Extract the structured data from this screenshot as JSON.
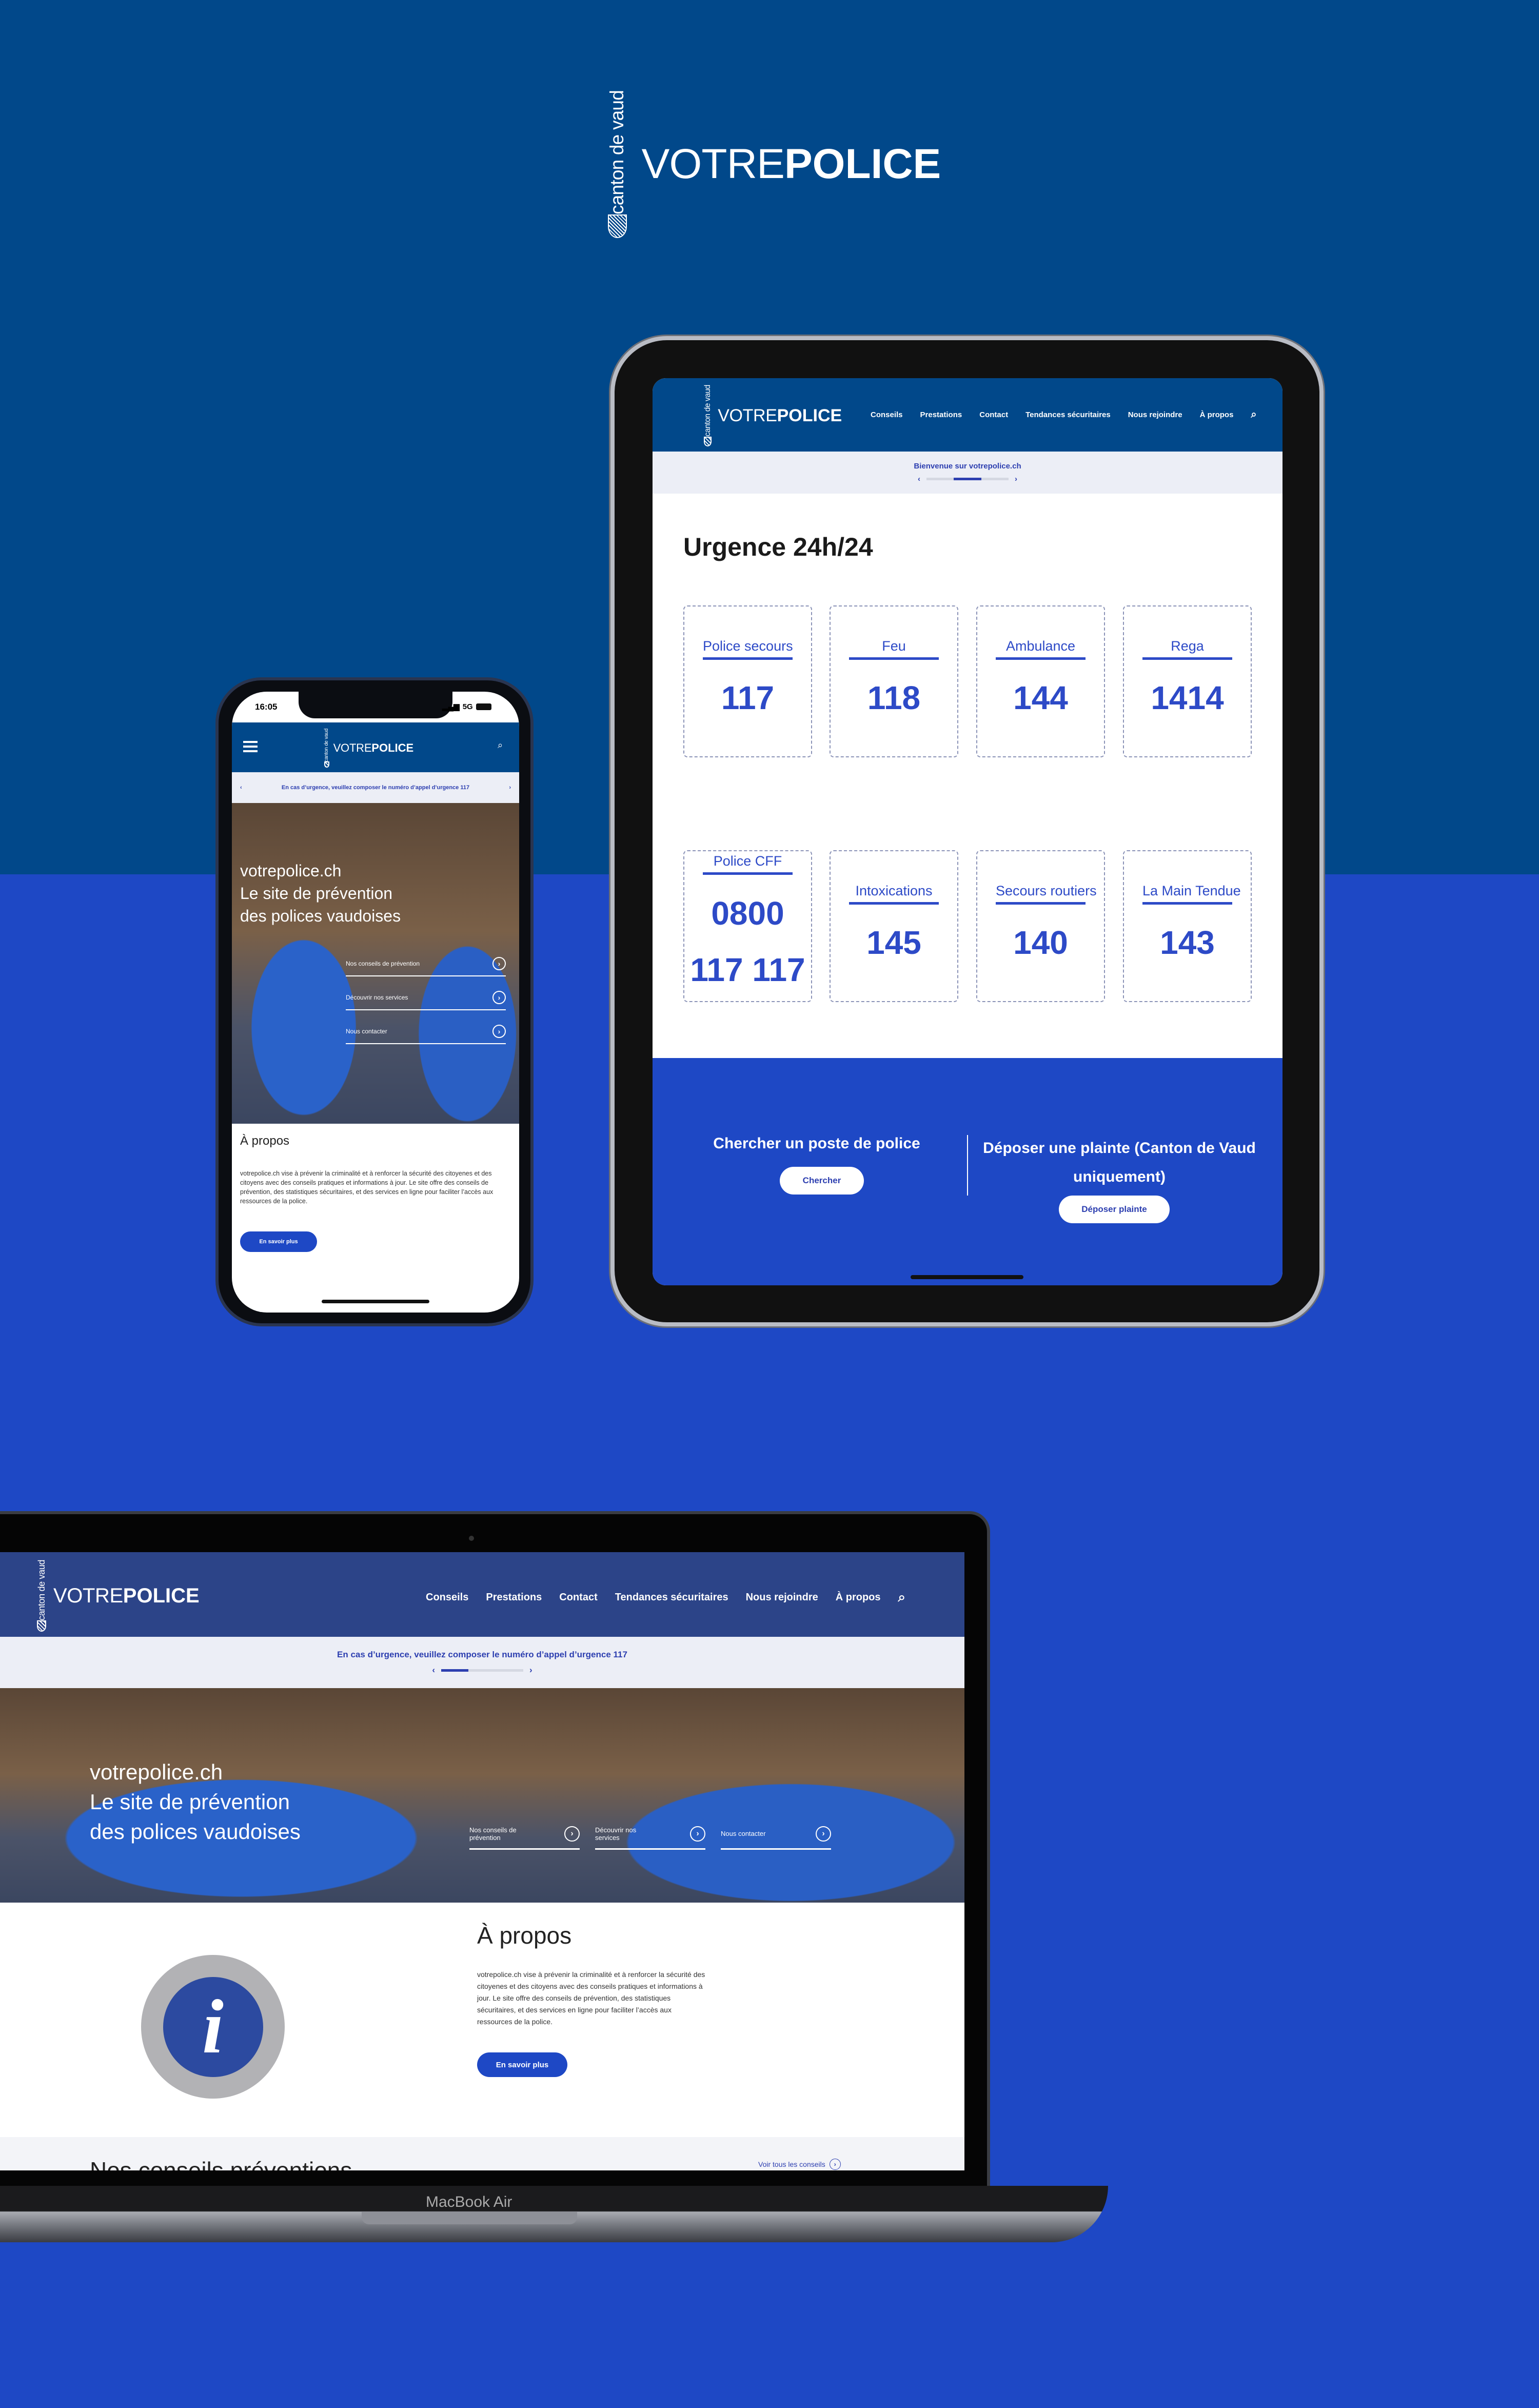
{
  "brand": {
    "seal_text": "canton de vaud",
    "name_light": "VOTRE",
    "name_bold": "POLICE"
  },
  "colors": {
    "dark_blue": "#01488a",
    "accent_blue": "#1e48c5",
    "laptop_header": "#2c4488",
    "banner_bg": "#eceef6"
  },
  "nav": {
    "items": [
      "Conseils",
      "Prestations",
      "Contact",
      "Tendances sécuritaires",
      "Nous rejoindre",
      "À propos"
    ],
    "search_icon": "search-icon"
  },
  "tablet": {
    "banner_text": "Bienvenue sur votrepolice.ch",
    "carousel_progress": 0.5,
    "title": "Urgence 24h/24",
    "cards": [
      {
        "label": "Police secours",
        "number": "117"
      },
      {
        "label": "Feu",
        "number": "118"
      },
      {
        "label": "Ambulance",
        "number": "144"
      },
      {
        "label": "Rega",
        "number": "1414"
      },
      {
        "label": "Police CFF",
        "number": "0800 117 117"
      },
      {
        "label": "Intoxications",
        "number": "145"
      },
      {
        "label": "Secours routiers",
        "number": "140"
      },
      {
        "label": "La Main Tendue",
        "number": "143"
      }
    ],
    "find_title": "Chercher un poste de police",
    "find_button": "Chercher",
    "complaint_title": "Déposer une plainte (Canton de Vaud uniquement)",
    "complaint_button": "Déposer plainte"
  },
  "phone": {
    "time": "16:05",
    "network": "5G",
    "banner_text": "En cas d’urgence, veuillez composer le numéro d’appel d’urgence 117",
    "hero_line1": "votrepolice.ch",
    "hero_line2": "Le site de prévention",
    "hero_line3": "des polices vaudoises",
    "links": [
      "Nos conseils de prévention",
      "Découvrir nos services",
      "Nous contacter"
    ],
    "about_title": "À propos",
    "about_text": "votrepolice.ch vise à prévenir la criminalité et à renforcer la sécurité des citoyenes et des citoyens avec des conseils pratiques et informations à jour. Le site offre des conseils de prévention, des statistiques sécuritaires, et des services en ligne pour faciliter l’accès aux ressources de la police.",
    "about_button": "En savoir plus"
  },
  "laptop": {
    "banner_text": "En cas d’urgence, veuillez composer le numéro d’appel d’urgence 117",
    "carousel_progress": 0.33,
    "hero_line1": "votrepolice.ch",
    "hero_line2": "Le site de prévention",
    "hero_line3": "des polices vaudoises",
    "links": [
      "Nos conseils de prévention",
      "Découvrir nos services",
      "Nous contacter"
    ],
    "about_title": "À propos",
    "about_text": "votrepolice.ch vise à prévenir la criminalité et à renforcer la sécurité des citoyenes et des citoyens avec des conseils pratiques et informations à jour. Le site offre des conseils de prévention, des statistiques sécuritaires, et des services en ligne pour faciliter l’accès aux ressources de la police.",
    "about_button": "En savoir plus",
    "tips_title": "Nos conseils préventions",
    "tips_link": "Voir tous les conseils",
    "device_label": "MacBook Air"
  }
}
